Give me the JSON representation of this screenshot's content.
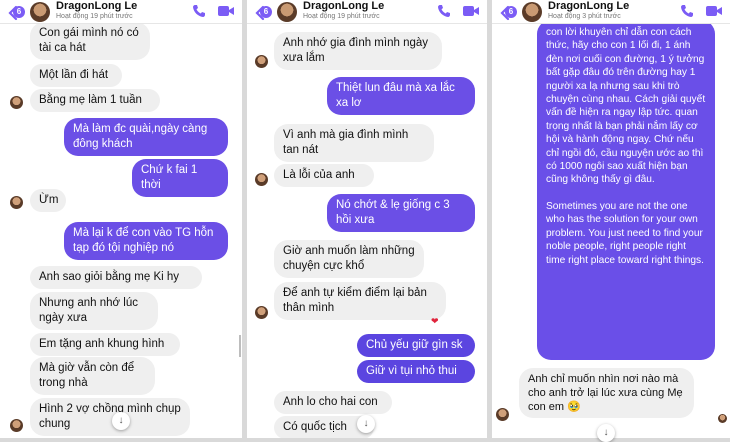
{
  "colors": {
    "accent": "#6b4fe6",
    "incoming": "#efefef"
  },
  "panels": [
    {
      "header": {
        "badge": "6",
        "name": "DragonLong Le",
        "status": "Hoạt động 19 phút trước"
      },
      "messages": [
        "Con gái mình nó có tài ca hát",
        "Một lần đi hát",
        "Bằng mẹ làm 1 tuần",
        "Mà làm đc quài,ngày càng đông khách",
        "Chứ k fai 1 thời",
        "Ừm",
        "Mà lại k để con vào TG hỗn tạp đó tội nghiệp nó",
        "Anh sao giỏi bằng mẹ Ki hy",
        "Nhưng anh nhớ lúc ngày xưa",
        "Em tặng anh khung hình",
        "Mà giờ vẫn còn để trong nhà",
        "Hình 2 vợ chồng mình chụp chung"
      ]
    },
    {
      "header": {
        "badge": "6",
        "name": "DragonLong Le",
        "status": "Hoạt động 19 phút trước"
      },
      "messages": [
        "Anh nhớ gia đình mình ngày xưa lắm",
        "Thiệt lun đâu mà xa lắc xa lơ",
        "Vì anh mà gia đình mình tan nát",
        "Là lỗi của anh",
        "Nó chớt & lẹ giống c 3 hồi xưa",
        "Giờ anh muốn làm những chuyện cực khổ",
        "Để anh tự kiểm điểm lại bản thân mình",
        "Chủ yếu giữ gìn sk",
        "Giữ vì tụi nhỏ thui",
        "Anh lo cho hai con",
        "Có quốc tịch"
      ]
    },
    {
      "header": {
        "badge": "6",
        "name": "DragonLong Le",
        "status": "Hoạt động 3 phút trước"
      },
      "long_message_vi": "con lời khuyên chỉ dẫn con cách thức, hãy cho con 1 lối đi, 1 ánh đèn nơi cuối con đường, 1 ý tưởng bất gặp đâu đó trên đường hay 1 người xa lạ nhưng sau khi trò chuyện cùng nhau. Cách giải quyết vấn đề hiện ra ngay lập tức. quan trọng nhất là bạn phải nắm lấy cơ hội và hành động ngay. Chứ nếu chỉ ngồi đó, cầu nguyện ước ao thì có 1000 ngôi sao xuất hiện bạn cũng không thấy gì đâu.",
      "long_message_en": "Sometimes you are not the one who has the solution for your own problem. You just need to find your noble people, right people right time right place toward right things.",
      "reply": "Anh chỉ muốn nhìn nơi nào mà cho anh trở lại lúc xưa cùng Mẹ con em 🥹"
    }
  ],
  "icons": [
    "back-arrow-icon",
    "phone-icon",
    "video-call-icon",
    "chevron-down-icon",
    "heart-reaction-icon"
  ]
}
